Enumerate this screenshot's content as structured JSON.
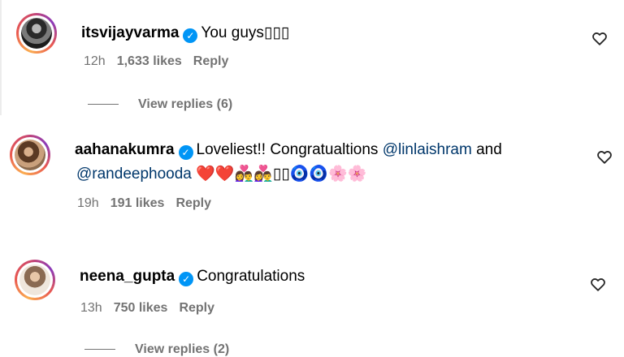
{
  "comments": [
    {
      "username": "itsvijayvarma",
      "text": "You guys▯▯▯",
      "time": "12h",
      "likes": "1,633 likes",
      "reply": "Reply",
      "view_replies": "View replies (6)"
    },
    {
      "username": "aahanakumra",
      "text_before": "Loveliest!! Congratualtions ",
      "mention1": "@linlaishram",
      "text_mid": " and",
      "mention2": "@randeephooda",
      "emojis": "❤️❤️👩‍❤️‍👨👩‍❤️‍👨▯▯🧿🧿🌸🌸",
      "time": "19h",
      "likes": "191 likes",
      "reply": "Reply"
    },
    {
      "username": "neena_gupta",
      "text": "Congratulations",
      "time": "13h",
      "likes": "750 likes",
      "reply": "Reply",
      "view_replies": "View replies (2)"
    }
  ],
  "icons": {
    "verified": "verified-badge-icon",
    "like": "heart-outline-icon"
  },
  "colors": {
    "verified": "#0095f6",
    "mention": "#00376b",
    "meta": "#737373"
  }
}
